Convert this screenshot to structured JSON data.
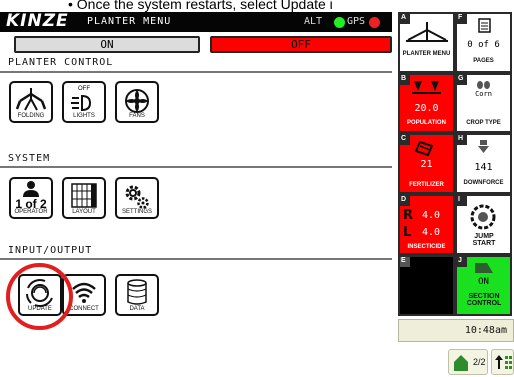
{
  "caption": "• Once the system restarts, select Update i",
  "header": {
    "brand": "KINZE",
    "menu_title": "PLANTER MENU",
    "alt_label": "ALT",
    "gps_label": "GPS"
  },
  "toggle": {
    "on_label": "ON",
    "off_label": "OFF",
    "active": "off"
  },
  "sections": [
    {
      "title": "PLANTER CONTROL",
      "tiles": [
        {
          "label": "FOLDING",
          "icon": "folding-icon"
        },
        {
          "label": "LIGHTS",
          "icon": "lights-icon",
          "top_label": "OFF"
        },
        {
          "label": "FANS",
          "icon": "fan-icon"
        }
      ]
    },
    {
      "title": "SYSTEM",
      "tiles": [
        {
          "label": "OPERATOR",
          "icon": "operator-icon",
          "value": "1 of 2"
        },
        {
          "label": "LAYOUT",
          "icon": "layout-icon"
        },
        {
          "label": "SETTINGS",
          "icon": "gears-icon"
        }
      ]
    },
    {
      "title": "INPUT/OUTPUT",
      "tiles": [
        {
          "label": "UPDATE",
          "icon": "update-icon",
          "highlighted": true
        },
        {
          "label": "CONNECT",
          "icon": "wifi-icon"
        },
        {
          "label": "DATA",
          "icon": "database-icon"
        }
      ]
    }
  ],
  "right_panel": {
    "cells": [
      {
        "id": "A",
        "label": "PLANTER MENU",
        "icon": "planter-icon",
        "color": "white"
      },
      {
        "id": "F",
        "label": "PAGES",
        "value": "0 of 6",
        "icon": "pages-icon",
        "color": "white"
      },
      {
        "id": "B",
        "label": "POPULATION",
        "value": "20.0",
        "icon": "population-icon",
        "color": "red"
      },
      {
        "id": "G",
        "label": "CROP TYPE",
        "value": "Corn",
        "icon": "seeds-icon",
        "color": "white"
      },
      {
        "id": "C",
        "label": "FERTILIZER",
        "value": "21",
        "icon": "fertilizer-icon",
        "color": "red"
      },
      {
        "id": "H",
        "label": "DOWNFORCE",
        "value": "141",
        "icon": "downforce-icon",
        "color": "white"
      },
      {
        "id": "D",
        "label": "INSECTICIDE",
        "rows": [
          {
            "side": "R",
            "value": "4.0"
          },
          {
            "side": "L",
            "value": "4.0"
          }
        ],
        "color": "red"
      },
      {
        "id": "I",
        "label": "JUMP START",
        "icon": "jump-start-icon",
        "color": "white"
      },
      {
        "id": "E",
        "label": "",
        "color": "black"
      },
      {
        "id": "J",
        "label": "SECTION CONTROL",
        "value": "ON",
        "icon": "section-icon",
        "color": "green"
      }
    ],
    "clock": "10:48am",
    "home_button": "2/2",
    "home_icon": "home-icon",
    "up_icon": "up-arrow-icon",
    "grid_icon": "grid-icon"
  },
  "colors": {
    "red": "#ff0000",
    "green": "#19e11f",
    "highlight_ring": "#e21e1e"
  }
}
